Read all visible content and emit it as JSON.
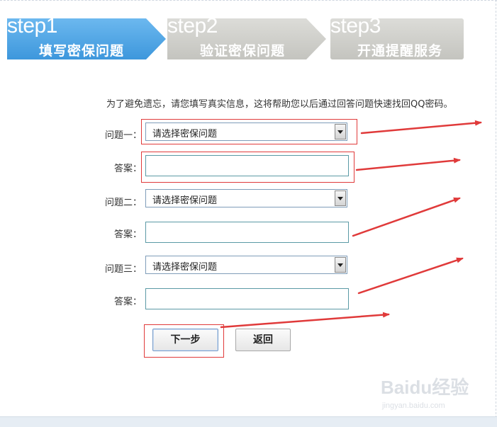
{
  "steps": [
    {
      "num": "step1",
      "title": "填写密保问题",
      "state": "active",
      "color": "#4aa3e6"
    },
    {
      "num": "step2",
      "title": "验证密保问题",
      "state": "inactive",
      "color": "#cfcfca"
    },
    {
      "num": "step3",
      "title": "开通提醒服务",
      "state": "inactive",
      "color": "#cfcfca"
    }
  ],
  "form": {
    "intro": "为了避免遗忘，请您填写真实信息，这将帮助您以后通过回答问题快速找回QQ密码。",
    "questions": [
      {
        "label": "问题一：",
        "select_value": "请选择密保问题",
        "answer_label": "答案：",
        "answer_value": ""
      },
      {
        "label": "问题二：",
        "select_value": "请选择密保问题",
        "answer_label": "答案：",
        "answer_value": ""
      },
      {
        "label": "问题三：",
        "select_value": "请选择密保问题",
        "answer_label": "答案：",
        "answer_value": ""
      }
    ],
    "next_label": "下一步",
    "back_label": "返回"
  },
  "annotation_color": "#e03a3a",
  "watermark": {
    "text": "Baidu经验",
    "sub": "jingyan.baidu.com"
  }
}
